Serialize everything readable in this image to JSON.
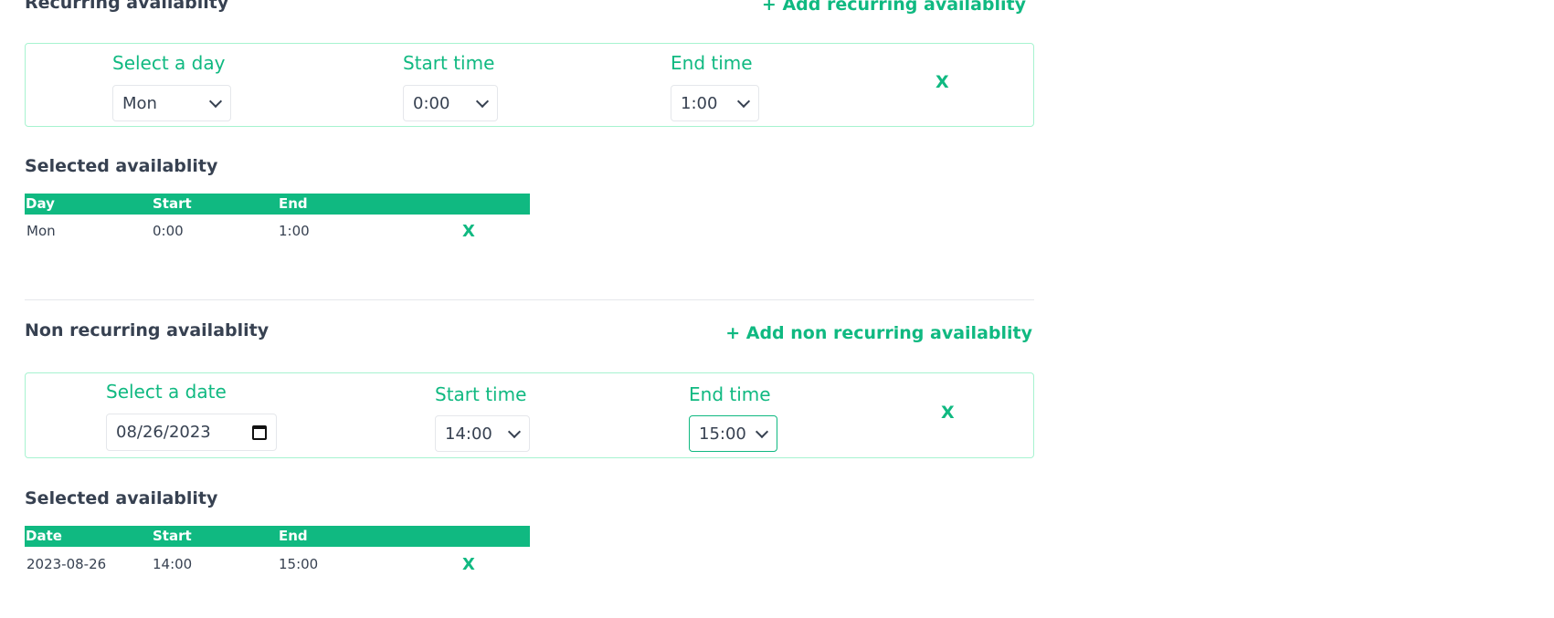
{
  "recurring": {
    "title": "Recurring availablity",
    "add_label": "+ Add recurring availablity",
    "form": {
      "day_label": "Select a day",
      "day_value": "Mon",
      "start_label": "Start time",
      "start_value": "0:00",
      "end_label": "End time",
      "end_value": "1:00",
      "remove_label": "X"
    },
    "selected_title": "Selected availablity",
    "table": {
      "headers": [
        "Day",
        "Start",
        "End"
      ],
      "rows": [
        {
          "day": "Mon",
          "start": "0:00",
          "end": "1:00",
          "remove": "X"
        }
      ]
    }
  },
  "non_recurring": {
    "title": "Non recurring availablity",
    "add_label": "+ Add non recurring availablity",
    "form": {
      "date_label": "Select a date",
      "date_value": "08/26/2023",
      "start_label": "Start time",
      "start_value": "14:00",
      "end_label": "End time",
      "end_value": "15:00",
      "remove_label": "X"
    },
    "selected_title": "Selected availablity",
    "table": {
      "headers": [
        "Date",
        "Start",
        "End"
      ],
      "rows": [
        {
          "date": "2023-08-26",
          "start": "14:00",
          "end": "15:00",
          "remove": "X"
        }
      ]
    }
  },
  "icons": {
    "select_chevron": "chevron-down-icon",
    "date_picker": "calendar-icon"
  },
  "colors": {
    "accent": "#10b981",
    "panel_border": "#a7f3d0",
    "text": "#374151",
    "divider": "#e5e7eb"
  }
}
